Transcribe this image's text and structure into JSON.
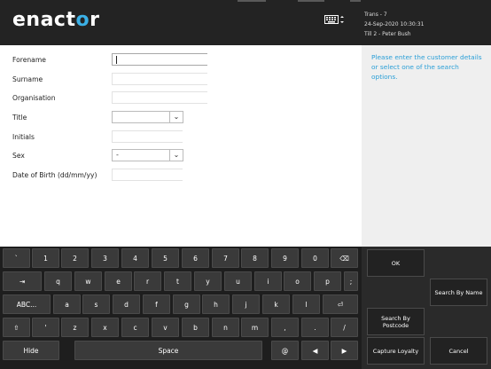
{
  "header": {
    "logo_prefix": "enact",
    "logo_o": "o",
    "logo_suffix": "r",
    "trans": "Trans - 7",
    "datetime": "24-Sep-2020 10:30:31",
    "till": "Till 2 - Peter Bush",
    "keyboard_icon": "keyboard-icon"
  },
  "form": {
    "fields": [
      {
        "label": "Forename",
        "value": ""
      },
      {
        "label": "Surname",
        "value": ""
      },
      {
        "label": "Organisation",
        "value": ""
      },
      {
        "label": "Title",
        "value": ""
      },
      {
        "label": "Initials",
        "value": ""
      },
      {
        "label": "Sex",
        "value": "-"
      },
      {
        "label": "Date of Birth (dd/mm/yy)",
        "value": ""
      }
    ],
    "dropdown_arrow": "⌄"
  },
  "hint": "Please enter the customer details or select one of the search options.",
  "keyboard": {
    "row1": [
      "`",
      "1",
      "2",
      "3",
      "4",
      "5",
      "6",
      "7",
      "8",
      "9",
      "0",
      "⌫"
    ],
    "row2": [
      "⇥",
      "q",
      "w",
      "e",
      "r",
      "t",
      "y",
      "u",
      "i",
      "o",
      "p",
      ";"
    ],
    "row3": [
      "ABC...",
      "a",
      "s",
      "d",
      "f",
      "g",
      "h",
      "j",
      "k",
      "l",
      "⏎"
    ],
    "row4": [
      "⇧",
      "'",
      "z",
      "x",
      "c",
      "v",
      "b",
      "n",
      "m",
      ",",
      ".",
      "/"
    ],
    "row5": [
      "Hide",
      "Space",
      "@",
      "◀",
      "▶"
    ]
  },
  "actions": {
    "ok": "OK",
    "search_by_name": "Search By Name",
    "search_by_postcode": "Search By Postcode",
    "capture_loyalty": "Capture Loyalty",
    "cancel": "Cancel"
  }
}
